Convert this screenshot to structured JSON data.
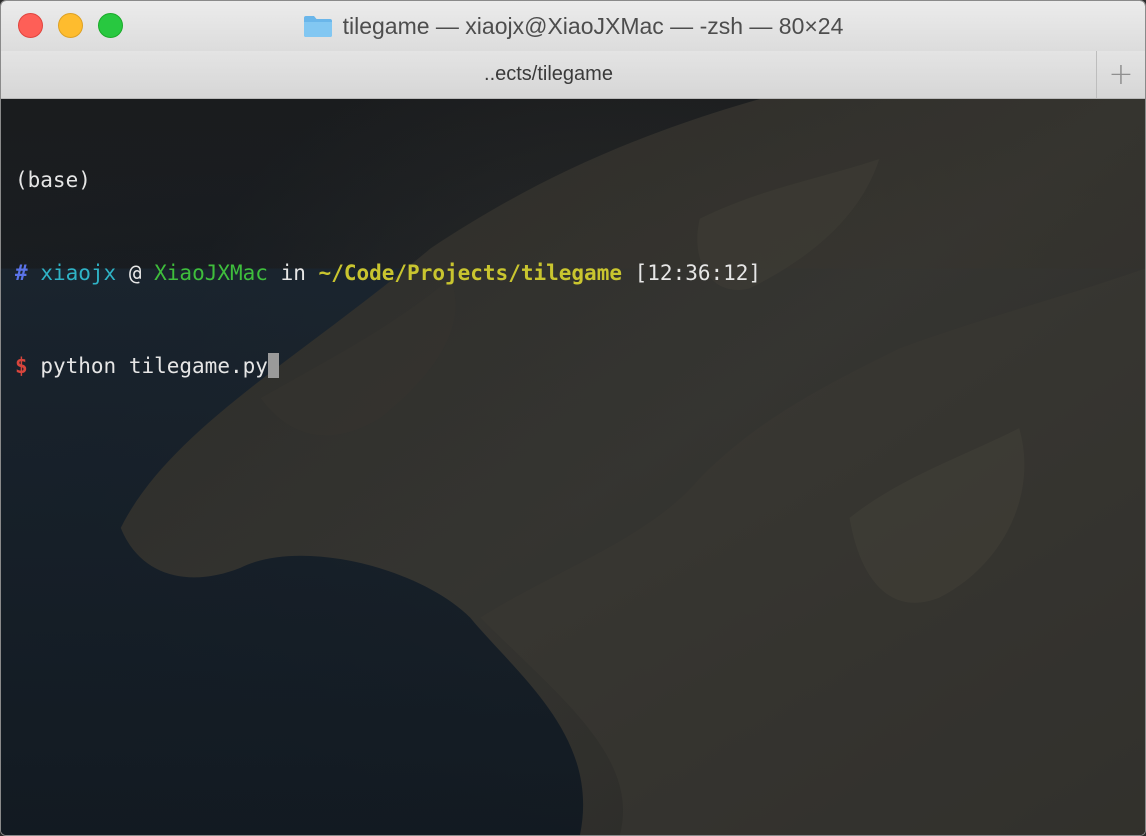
{
  "window": {
    "title": "tilegame — xiaojx@XiaoJXMac — -zsh — 80×24",
    "folder_icon": "folder-icon"
  },
  "tabs": [
    {
      "label": "..ects/tilegame"
    }
  ],
  "new_tab_label": "+",
  "colors": {
    "close": "#fe5f57",
    "minimize": "#febc2e",
    "maximize": "#28c840",
    "hash": "#5a73e8",
    "user": "#2fb3c6",
    "host": "#3fbe3c",
    "path": "#c9c52f",
    "dollar": "#d8453c"
  },
  "terminal": {
    "env_line": "(base)",
    "prompt": {
      "hash": "#",
      "user": "xiaojx",
      "at": "@",
      "host": "XiaoJXMac",
      "in": "in",
      "path": "~/Code/Projects/tilegame",
      "time": "[12:36:12]"
    },
    "command_line": {
      "dollar": "$",
      "command": "python tilegame.py"
    }
  }
}
